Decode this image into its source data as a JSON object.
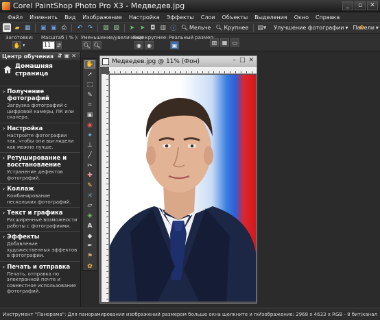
{
  "window": {
    "title": "Corel PaintShop Photo Pro X3 - Медведев.jpg"
  },
  "menu": [
    "Файл",
    "Изменить",
    "Вид",
    "Изображение",
    "Настройка",
    "Эффекты",
    "Слои",
    "Объекты",
    "Выделения",
    "Окно",
    "Справка"
  ],
  "toolbar": {
    "zoom_out_label": "Мельче",
    "zoom_in_label": "Крупнее",
    "enhance_label": "Улучшение фотографии",
    "panels_label": "Панели"
  },
  "options": {
    "presets_label": "Заготовки:",
    "scale_label": "Масштаб ( % ):",
    "scale_value": "11",
    "zoom_label": "Уменьшение/увеличение:",
    "more_label": "Еще крупнее:",
    "real_size_label": "Реальный размер:"
  },
  "learning_center": {
    "title": "Центр обучения",
    "home_label": "Домашняя страница",
    "sections": [
      {
        "title": "Получение фотографий",
        "desc": "Загрузка фотографий с цифровой камеры, ПК или сканера."
      },
      {
        "title": "Настройка",
        "desc": "Настройте фотографии так, чтобы они выглядели как можно лучше."
      },
      {
        "title": "Ретуширование и восстановление",
        "desc": "Устранение дефектов фотографий."
      },
      {
        "title": "Коллаж",
        "desc": "Комбинирование нескольких фотографий."
      },
      {
        "title": "Текст и графика",
        "desc": "Расширенные возможности работы с фотографиями."
      },
      {
        "title": "Эффекты",
        "desc": "Добавление художественных эффектов в фотографии."
      },
      {
        "title": "Печать и отправка",
        "desc": "Печать, отправка по электронной почте и совместное использование фотографий."
      }
    ]
  },
  "document": {
    "title": "Медведев.jpg @  11% (Фон)"
  },
  "status": {
    "left": "Инструмент \"Панорама\": Для панорамирования изображений размером больше окна щелкните и перетащите.",
    "right": "Изображение:  2968 x 4633 x RGB - 8 бит/канал"
  },
  "colors": {
    "background": "#2b2b2b",
    "flag_blue": "#2d5fd6",
    "flag_red": "#d01a1e"
  }
}
